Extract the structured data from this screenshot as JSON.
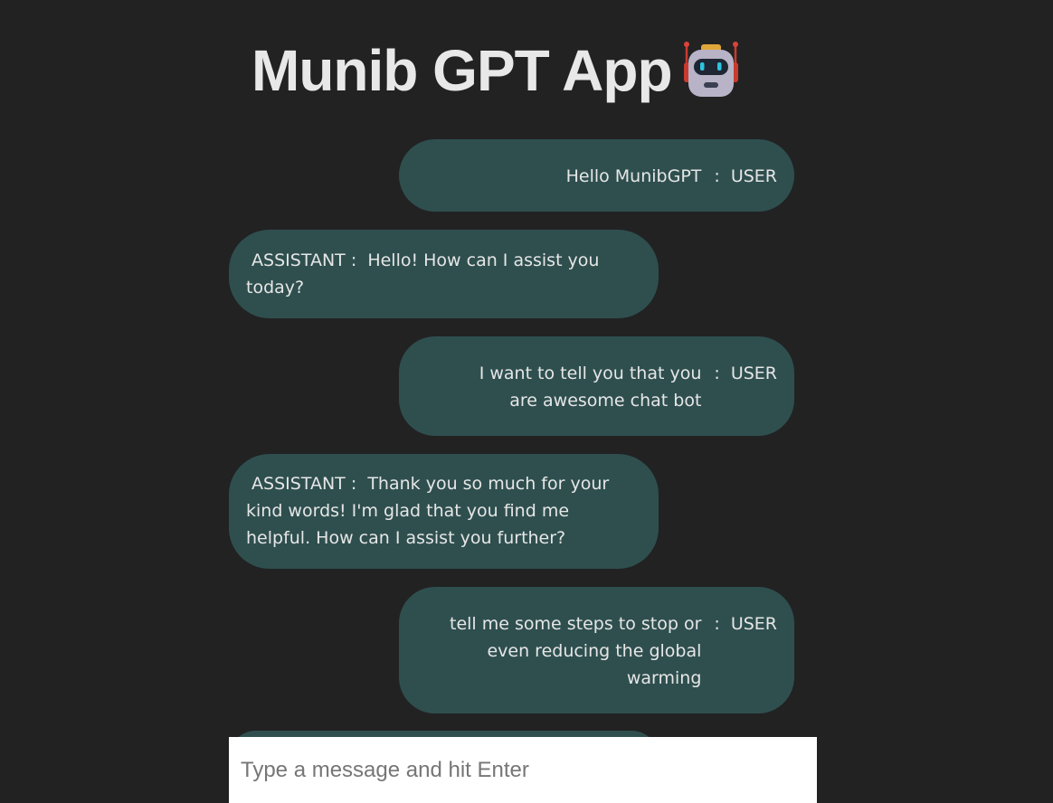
{
  "header": {
    "title": "Munib GPT App",
    "title_icon": "robot-icon"
  },
  "chat": {
    "messages": [
      {
        "role": "user",
        "role_label": "USER",
        "text": "Hello MunibGPT"
      },
      {
        "role": "assistant",
        "role_label": "ASSISTANT",
        "text": "Hello! How can I assist you today?"
      },
      {
        "role": "user",
        "role_label": "USER",
        "text": "I want to tell you that you are awesome chat bot"
      },
      {
        "role": "assistant",
        "role_label": "ASSISTANT",
        "text": "Thank you so much for your kind words! I'm glad that you find me helpful. How can I assist you further?"
      },
      {
        "role": "user",
        "role_label": "USER",
        "text": "tell me some steps to stop or even reducing the global warming"
      }
    ],
    "separator": ":"
  },
  "composer": {
    "placeholder": "Type a message and hit Enter",
    "value": ""
  },
  "colors": {
    "background": "#222222",
    "bubble": "#2f4f4f",
    "text": "#e6e6e6"
  }
}
